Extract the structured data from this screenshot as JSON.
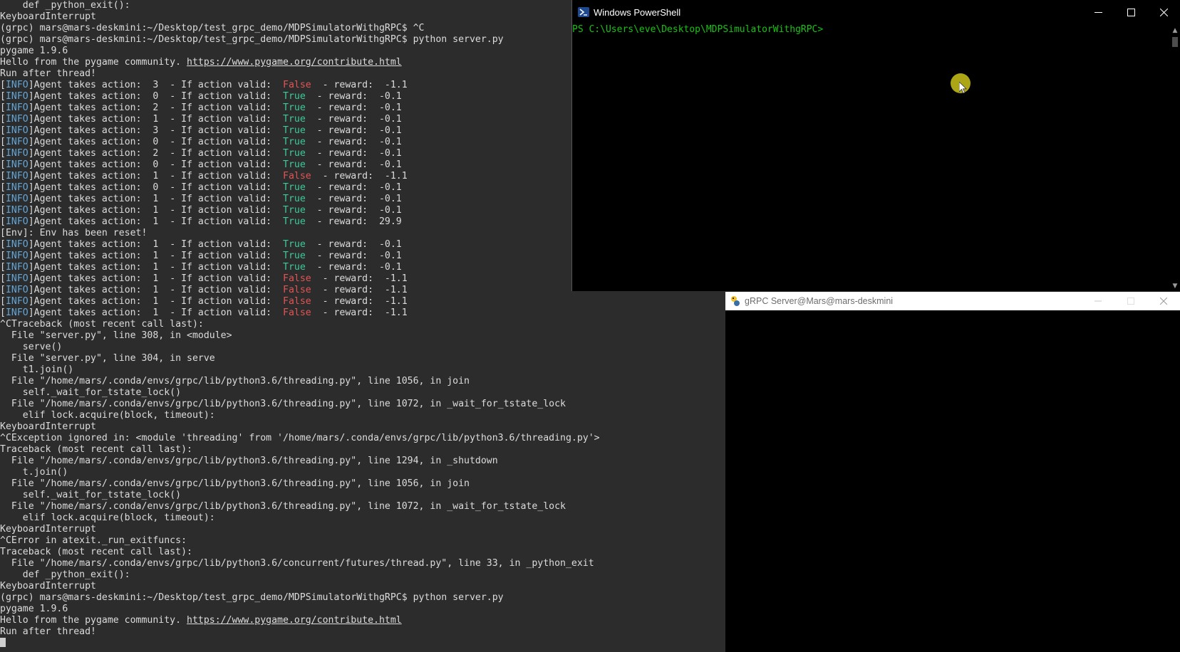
{
  "terminal": {
    "lines": [
      [
        {
          "t": "    def _python_exit():"
        }
      ],
      [
        {
          "t": "KeyboardInterrupt"
        }
      ],
      [
        {
          "t": "(grpc) mars@mars-deskmini:~/Desktop/test_grpc_demo/MDPSimulatorWithgRPC$ ^C"
        }
      ],
      [
        {
          "t": "(grpc) mars@mars-deskmini:~/Desktop/test_grpc_demo/MDPSimulatorWithgRPC$ python server.py"
        }
      ],
      [
        {
          "t": "pygame 1.9.6"
        }
      ],
      [
        {
          "t": "Hello from the pygame community. "
        },
        {
          "t": "https://www.pygame.org/contribute.html",
          "c": "link"
        }
      ],
      [
        {
          "t": "Run after thread!"
        }
      ],
      [
        {
          "t": "["
        },
        {
          "t": "INFO",
          "c": "info"
        },
        {
          "t": "]Agent takes action:  3  - If action valid:  "
        },
        {
          "t": "False",
          "c": "false"
        },
        {
          "t": "  - reward:  -1.1"
        }
      ],
      [
        {
          "t": "["
        },
        {
          "t": "INFO",
          "c": "info"
        },
        {
          "t": "]Agent takes action:  0  - If action valid:  "
        },
        {
          "t": "True",
          "c": "true"
        },
        {
          "t": "  - reward:  -0.1"
        }
      ],
      [
        {
          "t": "["
        },
        {
          "t": "INFO",
          "c": "info"
        },
        {
          "t": "]Agent takes action:  2  - If action valid:  "
        },
        {
          "t": "True",
          "c": "true"
        },
        {
          "t": "  - reward:  -0.1"
        }
      ],
      [
        {
          "t": "["
        },
        {
          "t": "INFO",
          "c": "info"
        },
        {
          "t": "]Agent takes action:  1  - If action valid:  "
        },
        {
          "t": "True",
          "c": "true"
        },
        {
          "t": "  - reward:  -0.1"
        }
      ],
      [
        {
          "t": "["
        },
        {
          "t": "INFO",
          "c": "info"
        },
        {
          "t": "]Agent takes action:  3  - If action valid:  "
        },
        {
          "t": "True",
          "c": "true"
        },
        {
          "t": "  - reward:  -0.1"
        }
      ],
      [
        {
          "t": "["
        },
        {
          "t": "INFO",
          "c": "info"
        },
        {
          "t": "]Agent takes action:  0  - If action valid:  "
        },
        {
          "t": "True",
          "c": "true"
        },
        {
          "t": "  - reward:  -0.1"
        }
      ],
      [
        {
          "t": "["
        },
        {
          "t": "INFO",
          "c": "info"
        },
        {
          "t": "]Agent takes action:  2  - If action valid:  "
        },
        {
          "t": "True",
          "c": "true"
        },
        {
          "t": "  - reward:  -0.1"
        }
      ],
      [
        {
          "t": "["
        },
        {
          "t": "INFO",
          "c": "info"
        },
        {
          "t": "]Agent takes action:  0  - If action valid:  "
        },
        {
          "t": "True",
          "c": "true"
        },
        {
          "t": "  - reward:  -0.1"
        }
      ],
      [
        {
          "t": "["
        },
        {
          "t": "INFO",
          "c": "info"
        },
        {
          "t": "]Agent takes action:  1  - If action valid:  "
        },
        {
          "t": "False",
          "c": "false"
        },
        {
          "t": "  - reward:  -1.1"
        }
      ],
      [
        {
          "t": "["
        },
        {
          "t": "INFO",
          "c": "info"
        },
        {
          "t": "]Agent takes action:  0  - If action valid:  "
        },
        {
          "t": "True",
          "c": "true"
        },
        {
          "t": "  - reward:  -0.1"
        }
      ],
      [
        {
          "t": "["
        },
        {
          "t": "INFO",
          "c": "info"
        },
        {
          "t": "]Agent takes action:  1  - If action valid:  "
        },
        {
          "t": "True",
          "c": "true"
        },
        {
          "t": "  - reward:  -0.1"
        }
      ],
      [
        {
          "t": "["
        },
        {
          "t": "INFO",
          "c": "info"
        },
        {
          "t": "]Agent takes action:  1  - If action valid:  "
        },
        {
          "t": "True",
          "c": "true"
        },
        {
          "t": "  - reward:  -0.1"
        }
      ],
      [
        {
          "t": "["
        },
        {
          "t": "INFO",
          "c": "info"
        },
        {
          "t": "]Agent takes action:  1  - If action valid:  "
        },
        {
          "t": "True",
          "c": "true"
        },
        {
          "t": "  - reward:  29.9"
        }
      ],
      [
        {
          "t": "[Env]: Env has been reset!"
        }
      ],
      [
        {
          "t": "["
        },
        {
          "t": "INFO",
          "c": "info"
        },
        {
          "t": "]Agent takes action:  1  - If action valid:  "
        },
        {
          "t": "True",
          "c": "true"
        },
        {
          "t": "  - reward:  -0.1"
        }
      ],
      [
        {
          "t": "["
        },
        {
          "t": "INFO",
          "c": "info"
        },
        {
          "t": "]Agent takes action:  1  - If action valid:  "
        },
        {
          "t": "True",
          "c": "true"
        },
        {
          "t": "  - reward:  -0.1"
        }
      ],
      [
        {
          "t": "["
        },
        {
          "t": "INFO",
          "c": "info"
        },
        {
          "t": "]Agent takes action:  1  - If action valid:  "
        },
        {
          "t": "True",
          "c": "true"
        },
        {
          "t": "  - reward:  -0.1"
        }
      ],
      [
        {
          "t": "["
        },
        {
          "t": "INFO",
          "c": "info"
        },
        {
          "t": "]Agent takes action:  1  - If action valid:  "
        },
        {
          "t": "False",
          "c": "false"
        },
        {
          "t": "  - reward:  -1.1"
        }
      ],
      [
        {
          "t": "["
        },
        {
          "t": "INFO",
          "c": "info"
        },
        {
          "t": "]Agent takes action:  1  - If action valid:  "
        },
        {
          "t": "False",
          "c": "false"
        },
        {
          "t": "  - reward:  -1.1"
        }
      ],
      [
        {
          "t": "["
        },
        {
          "t": "INFO",
          "c": "info"
        },
        {
          "t": "]Agent takes action:  1  - If action valid:  "
        },
        {
          "t": "False",
          "c": "false"
        },
        {
          "t": "  - reward:  -1.1"
        }
      ],
      [
        {
          "t": "["
        },
        {
          "t": "INFO",
          "c": "info"
        },
        {
          "t": "]Agent takes action:  1  - If action valid:  "
        },
        {
          "t": "False",
          "c": "false"
        },
        {
          "t": "  - reward:  -1.1"
        }
      ],
      [
        {
          "t": "^CTraceback (most recent call last):"
        }
      ],
      [
        {
          "t": "  File \"server.py\", line 308, in <module>"
        }
      ],
      [
        {
          "t": "    serve()"
        }
      ],
      [
        {
          "t": "  File \"server.py\", line 304, in serve"
        }
      ],
      [
        {
          "t": "    t1.join()"
        }
      ],
      [
        {
          "t": "  File \"/home/mars/.conda/envs/grpc/lib/python3.6/threading.py\", line 1056, in join"
        }
      ],
      [
        {
          "t": "    self._wait_for_tstate_lock()"
        }
      ],
      [
        {
          "t": "  File \"/home/mars/.conda/envs/grpc/lib/python3.6/threading.py\", line 1072, in _wait_for_tstate_lock"
        }
      ],
      [
        {
          "t": "    elif lock.acquire(block, timeout):"
        }
      ],
      [
        {
          "t": "KeyboardInterrupt"
        }
      ],
      [
        {
          "t": "^CException ignored in: <module 'threading' from '/home/mars/.conda/envs/grpc/lib/python3.6/threading.py'>"
        }
      ],
      [
        {
          "t": "Traceback (most recent call last):"
        }
      ],
      [
        {
          "t": "  File \"/home/mars/.conda/envs/grpc/lib/python3.6/threading.py\", line 1294, in _shutdown"
        }
      ],
      [
        {
          "t": "    t.join()"
        }
      ],
      [
        {
          "t": "  File \"/home/mars/.conda/envs/grpc/lib/python3.6/threading.py\", line 1056, in join"
        }
      ],
      [
        {
          "t": "    self._wait_for_tstate_lock()"
        }
      ],
      [
        {
          "t": "  File \"/home/mars/.conda/envs/grpc/lib/python3.6/threading.py\", line 1072, in _wait_for_tstate_lock"
        }
      ],
      [
        {
          "t": "    elif lock.acquire(block, timeout):"
        }
      ],
      [
        {
          "t": "KeyboardInterrupt"
        }
      ],
      [
        {
          "t": "^CError in atexit._run_exitfuncs:"
        }
      ],
      [
        {
          "t": "Traceback (most recent call last):"
        }
      ],
      [
        {
          "t": "  File \"/home/mars/.conda/envs/grpc/lib/python3.6/concurrent/futures/thread.py\", line 33, in _python_exit"
        }
      ],
      [
        {
          "t": "    def _python_exit():"
        }
      ],
      [
        {
          "t": "KeyboardInterrupt"
        }
      ],
      [
        {
          "t": "(grpc) mars@mars-deskmini:~/Desktop/test_grpc_demo/MDPSimulatorWithgRPC$ python server.py"
        }
      ],
      [
        {
          "t": "pygame 1.9.6"
        }
      ],
      [
        {
          "t": "Hello from the pygame community. "
        },
        {
          "t": "https://www.pygame.org/contribute.html",
          "c": "link"
        }
      ],
      [
        {
          "t": "Run after thread!"
        }
      ]
    ]
  },
  "powershell": {
    "title": "Windows PowerShell",
    "prompt": "PS C:\\Users\\eve\\Desktop\\MDPSimulatorWithgRPC>",
    "minimize": "—",
    "maximize": "☐",
    "close": "✕"
  },
  "grpc_window": {
    "title": "gRPC Server@Mars@mars-deskmini",
    "minimize": "—",
    "maximize": "☐",
    "close": "✕",
    "icon": "pygame-snake-icon"
  },
  "colors": {
    "term_bg": "#2c2c2c",
    "false": "#e05555",
    "true": "#3ec99e",
    "info": "#62a6d8",
    "ps_prompt": "#17c313"
  }
}
